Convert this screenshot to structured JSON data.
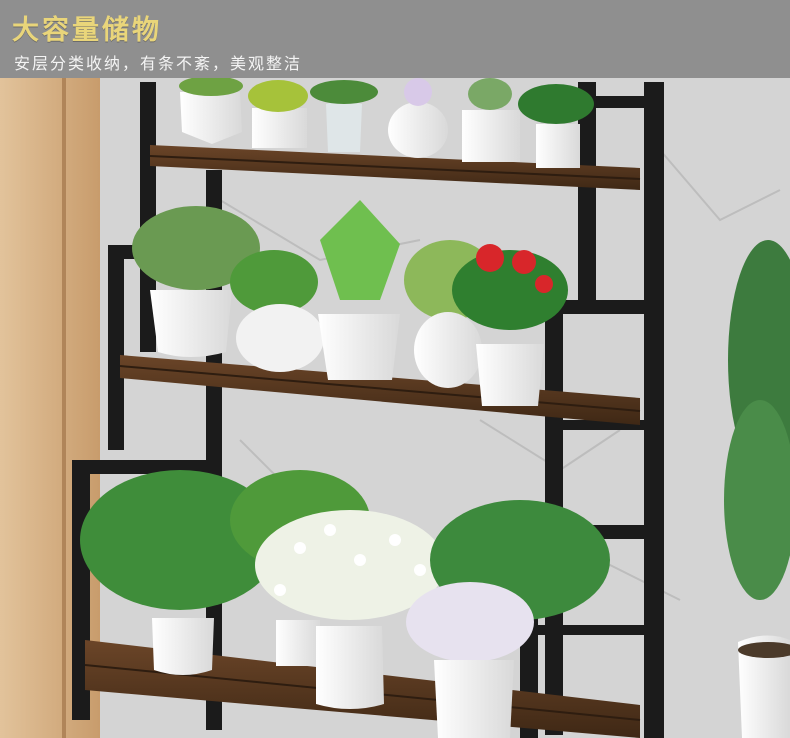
{
  "banner": {
    "title": "大容量储物",
    "subtitle": "安层分类收纳，有条不紊，美观整洁"
  },
  "colors": {
    "banner_bg": "#8f8f8f",
    "title": "#e9d57a",
    "subtitle": "#f4f4f4",
    "frame": "#1b1b1b",
    "wood": "#5a3a22",
    "wall": "#d9d9d9",
    "wood_panel": "#d8b48a"
  },
  "shelf_count": 3
}
